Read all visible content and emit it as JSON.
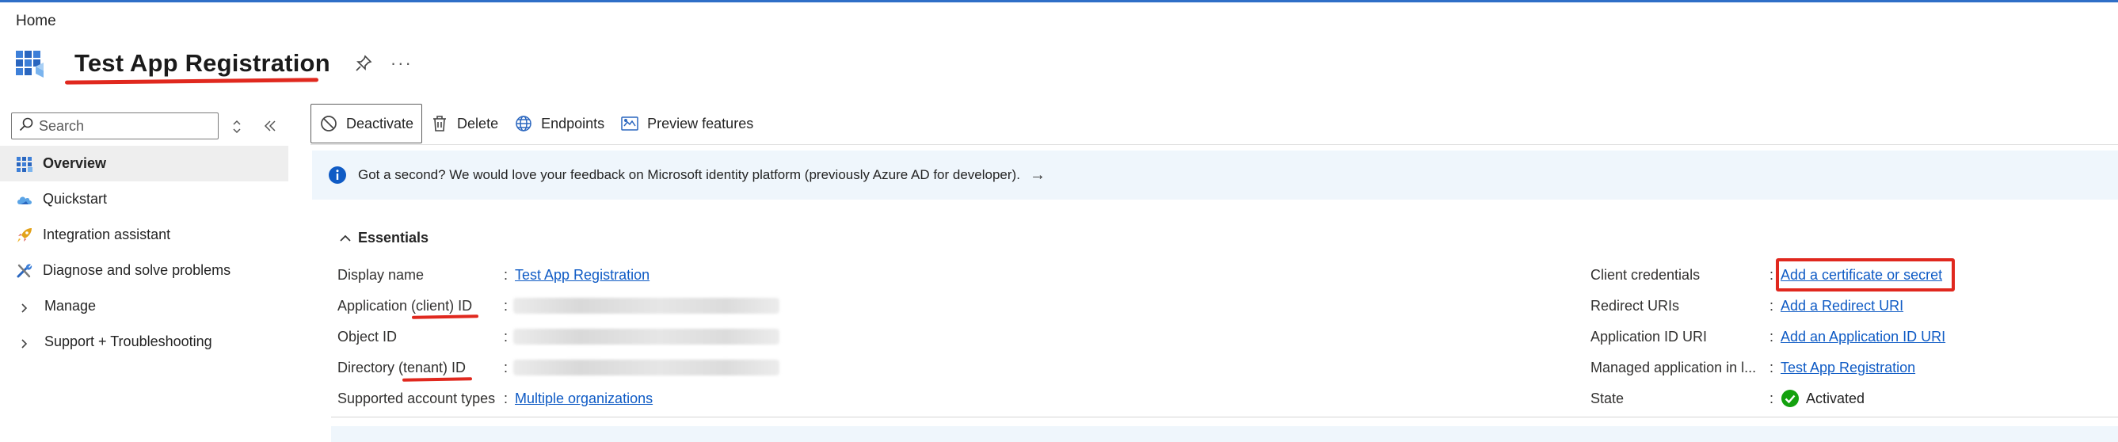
{
  "breadcrumb": "Home",
  "header": {
    "title": "Test App Registration",
    "more": "···"
  },
  "sidebar": {
    "search_placeholder": "Search",
    "items": [
      {
        "label": "Overview",
        "icon": "grid-icon",
        "active": true
      },
      {
        "label": "Quickstart",
        "icon": "cloud-icon"
      },
      {
        "label": "Integration assistant",
        "icon": "rocket-icon"
      },
      {
        "label": "Diagnose and solve problems",
        "icon": "wrench-icon"
      },
      {
        "label": "Manage",
        "icon": "chevron-right-icon"
      },
      {
        "label": "Support + Troubleshooting",
        "icon": "chevron-right-icon"
      }
    ]
  },
  "toolbar": {
    "deactivate": "Deactivate",
    "delete": "Delete",
    "endpoints": "Endpoints",
    "preview": "Preview features"
  },
  "banner": {
    "text": "Got a second? We would love your feedback on Microsoft identity platform (previously Azure AD for developer).",
    "arrow": "→"
  },
  "essentials": {
    "header": "Essentials",
    "left": [
      {
        "label": "Display name",
        "value": "Test App Registration",
        "link": true
      },
      {
        "label": "Application (client) ID",
        "value": ""
      },
      {
        "label": "Object ID",
        "value": ""
      },
      {
        "label": "Directory (tenant) ID",
        "value": ""
      },
      {
        "label": "Supported account types",
        "value": "Multiple organizations",
        "link": true
      }
    ],
    "right": [
      {
        "label": "Client credentials",
        "value": "Add a certificate or secret",
        "link": true
      },
      {
        "label": "Redirect URIs",
        "value": "Add a Redirect URI",
        "link": true
      },
      {
        "label": "Application ID URI",
        "value": "Add an Application ID URI",
        "link": true
      },
      {
        "label": "Managed application in l...",
        "value": "Test App Registration",
        "link": true
      },
      {
        "label": "State",
        "value": "Activated"
      }
    ]
  },
  "colors": {
    "accent": "#0f5bc5",
    "annotation": "#e0281e",
    "success": "#13a10e",
    "banner_bg": "#eff6fc"
  }
}
